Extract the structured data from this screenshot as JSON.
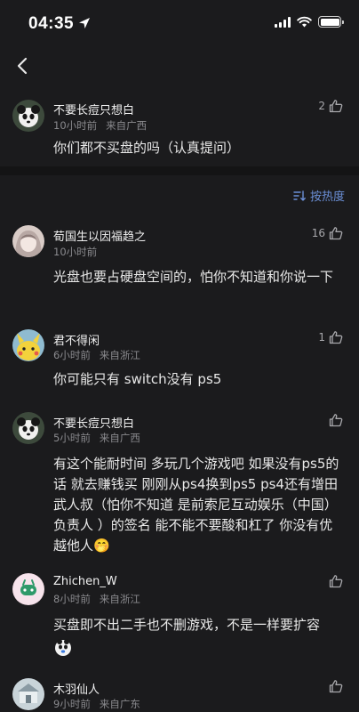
{
  "status": {
    "time": "04:35"
  },
  "main_comment": {
    "author": "不要长痘只想白",
    "time": "10小时前",
    "location": "来自广西",
    "likes": "2",
    "text": "你们都不买盘的吗（认真提问）"
  },
  "sort": {
    "label": "按热度"
  },
  "replies": [
    {
      "author": "荀国生以因福趋之",
      "time": "10小时前",
      "location": "来自浙江",
      "likes": "16",
      "text": "光盘也要占硬盘空间的，怕你不知道和你说一下"
    },
    {
      "author": "君不得闲",
      "time": "6小时前",
      "location": "来自浙江",
      "likes": "1",
      "text": "你可能只有 switch没有 ps5"
    },
    {
      "author": "不要长痘只想白",
      "time": "5小时前",
      "location": "来自广西",
      "likes": "",
      "text": "有这个能耐时间 多玩几个游戏吧 如果没有ps5的话 就去赚钱买 刚刚从ps4换到ps5 ps4还有增田武人叔（怕你不知道 是前索尼互动娱乐（中国）负责人 ）的签名 能不能不要酸和杠了 你没有优越他人🤭"
    },
    {
      "author": "Zhichen_W",
      "time": "8小时前",
      "location": "来自浙江",
      "likes": "",
      "text": "买盘即不出二手也不删游戏，不是一样要扩容"
    },
    {
      "author": "木羽仙人",
      "time": "9小时前",
      "location": "来自广东",
      "likes": ""
    }
  ],
  "icons": {
    "back": "chevron-left-icon",
    "like": "thumbs-up-icon",
    "sort": "sort-icon"
  }
}
